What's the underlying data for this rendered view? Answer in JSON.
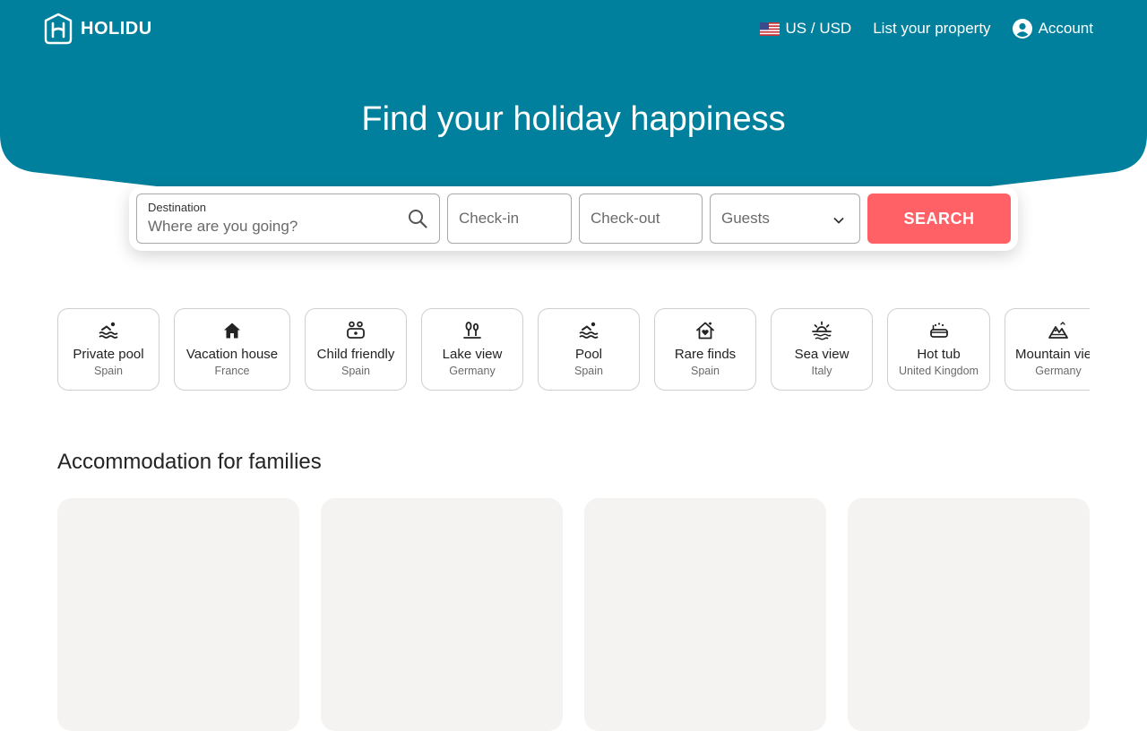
{
  "brand": {
    "name": "HOLIDU"
  },
  "nav": {
    "locale_label": "US / USD",
    "list_property_label": "List your property",
    "account_label": "Account"
  },
  "hero": {
    "title": "Find your holiday happiness"
  },
  "search": {
    "destination_label": "Destination",
    "destination_placeholder": "Where are you going?",
    "checkin_placeholder": "Check-in",
    "checkout_placeholder": "Check-out",
    "guests_placeholder": "Guests",
    "button_label": "SEARCH"
  },
  "categories": [
    {
      "label": "Private pool",
      "country": "Spain",
      "icon": "swimmer-icon"
    },
    {
      "label": "Vacation house",
      "country": "France",
      "icon": "house-icon"
    },
    {
      "label": "Child friendly",
      "country": "Spain",
      "icon": "family-icon"
    },
    {
      "label": "Lake view",
      "country": "Germany",
      "icon": "lake-icon"
    },
    {
      "label": "Pool",
      "country": "Spain",
      "icon": "swimmer-icon"
    },
    {
      "label": "Rare finds",
      "country": "Spain",
      "icon": "house-heart-icon"
    },
    {
      "label": "Sea view",
      "country": "Italy",
      "icon": "sunset-icon"
    },
    {
      "label": "Hot tub",
      "country": "United Kingdom",
      "icon": "bathtub-icon"
    },
    {
      "label": "Mountain view",
      "country": "Germany",
      "icon": "mountain-icon"
    }
  ],
  "sections": {
    "families_title": "Accommodation for families"
  },
  "colors": {
    "brand_teal": "#00809d",
    "search_button": "#ff6166",
    "card_placeholder": "#f4f3f2"
  }
}
